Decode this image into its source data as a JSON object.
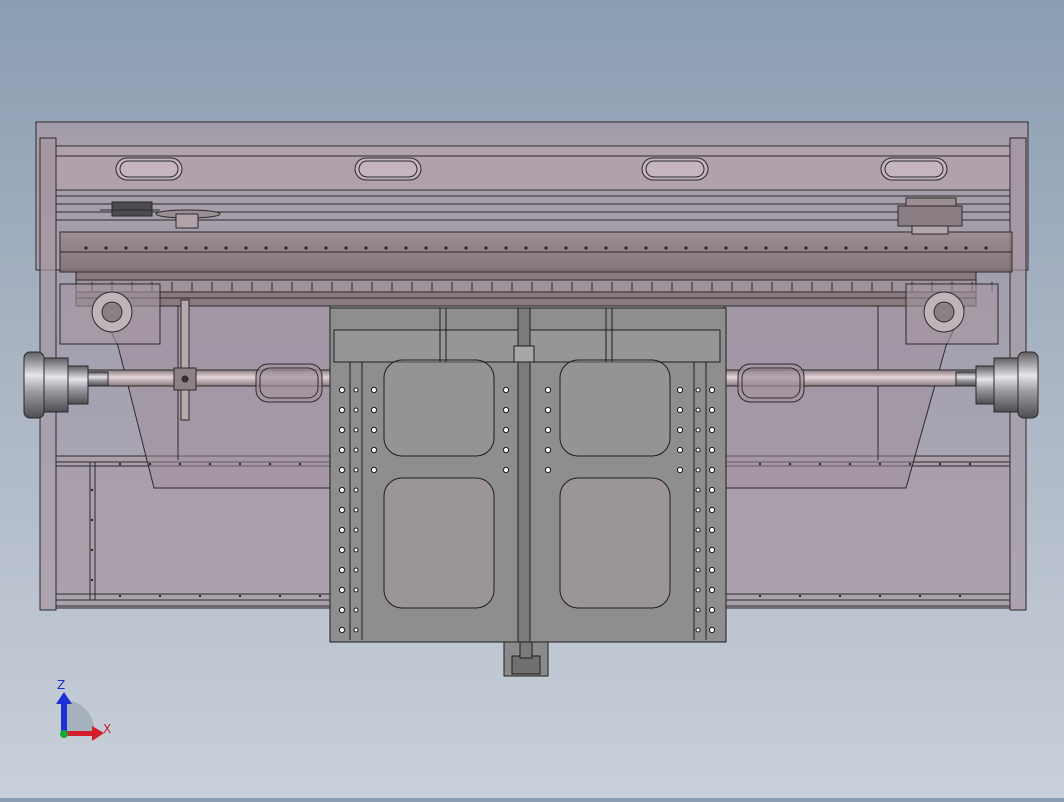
{
  "triad": {
    "z_label": "Z",
    "x_label": "X",
    "z_color": "#1e2fd6",
    "x_color": "#d41e2a",
    "y_color": "#18a83a"
  },
  "palette": {
    "background_top": "#8b9db2",
    "background_bottom": "#c9d0d9",
    "frame_fill": "#a99aa6",
    "carriage_fill": "#8f8f8f",
    "shaft_fill": "#b9a8ae",
    "edge_color": "#222222"
  },
  "icons": {
    "motor_left": "motor-icon",
    "motor_right": "motor-icon",
    "coupling": "coupling-icon"
  }
}
